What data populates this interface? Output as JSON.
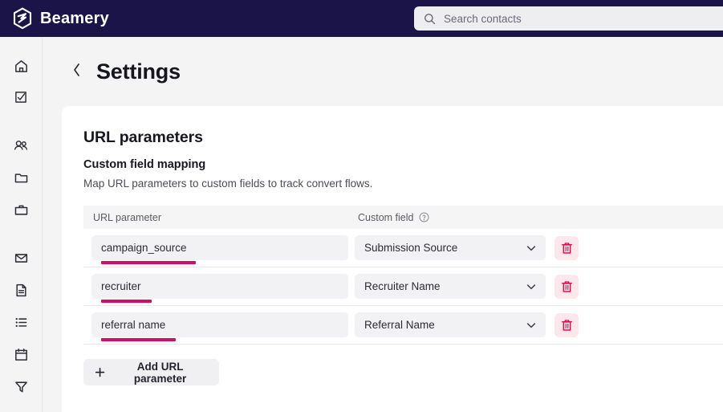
{
  "topbar": {
    "brand_name": "Beamery",
    "brand_logo_icon": "beamery-hexagon-logo",
    "search": {
      "icon": "search-icon",
      "placeholder": "Search contacts",
      "value": ""
    }
  },
  "sidebar": {
    "items": [
      {
        "icon": "home-icon",
        "name": "home"
      },
      {
        "icon": "task-check-icon",
        "name": "tasks"
      },
      {
        "icon": "people-icon",
        "name": "contacts"
      },
      {
        "icon": "folder-icon",
        "name": "pools"
      },
      {
        "icon": "briefcase-icon",
        "name": "vacancies"
      },
      {
        "icon": "mail-icon",
        "name": "campaigns"
      },
      {
        "icon": "document-icon",
        "name": "pages"
      },
      {
        "icon": "list-icon",
        "name": "lists"
      },
      {
        "icon": "calendar-icon",
        "name": "events"
      },
      {
        "icon": "filter-icon",
        "name": "filters"
      }
    ]
  },
  "page": {
    "back_icon": "chevron-left-icon",
    "title": "Settings"
  },
  "card": {
    "heading": "URL parameters",
    "subheading": "Custom field mapping",
    "description": "Map URL parameters to custom fields to track convert flows.",
    "table": {
      "columns": {
        "url_parameter": "URL parameter",
        "custom_field": "Custom field",
        "custom_field_help_icon": "help-circle-icon"
      },
      "rows": [
        {
          "url_parameter": "campaign_source",
          "custom_field": "Submission Source",
          "underline_width": 118,
          "dropdown_icon": "chevron-down-icon",
          "delete_icon": "trash-icon"
        },
        {
          "url_parameter": "recruiter",
          "custom_field": "Recruiter Name",
          "underline_width": 63,
          "dropdown_icon": "chevron-down-icon",
          "delete_icon": "trash-icon"
        },
        {
          "url_parameter": "referral name",
          "custom_field": "Referral Name",
          "underline_width": 93,
          "dropdown_icon": "chevron-down-icon",
          "delete_icon": "trash-icon"
        }
      ]
    },
    "add_button": {
      "label": "Add URL parameter",
      "icon": "plus-icon"
    }
  },
  "colors": {
    "brand_navy": "#1b1449",
    "annotation_magenta": "#ce0f69",
    "delete_red": "#d6134a",
    "delete_bg": "#fde7ec",
    "page_bg": "#f4f4f5",
    "card_bg": "#ffffff",
    "field_bg": "#f2f2f4"
  }
}
